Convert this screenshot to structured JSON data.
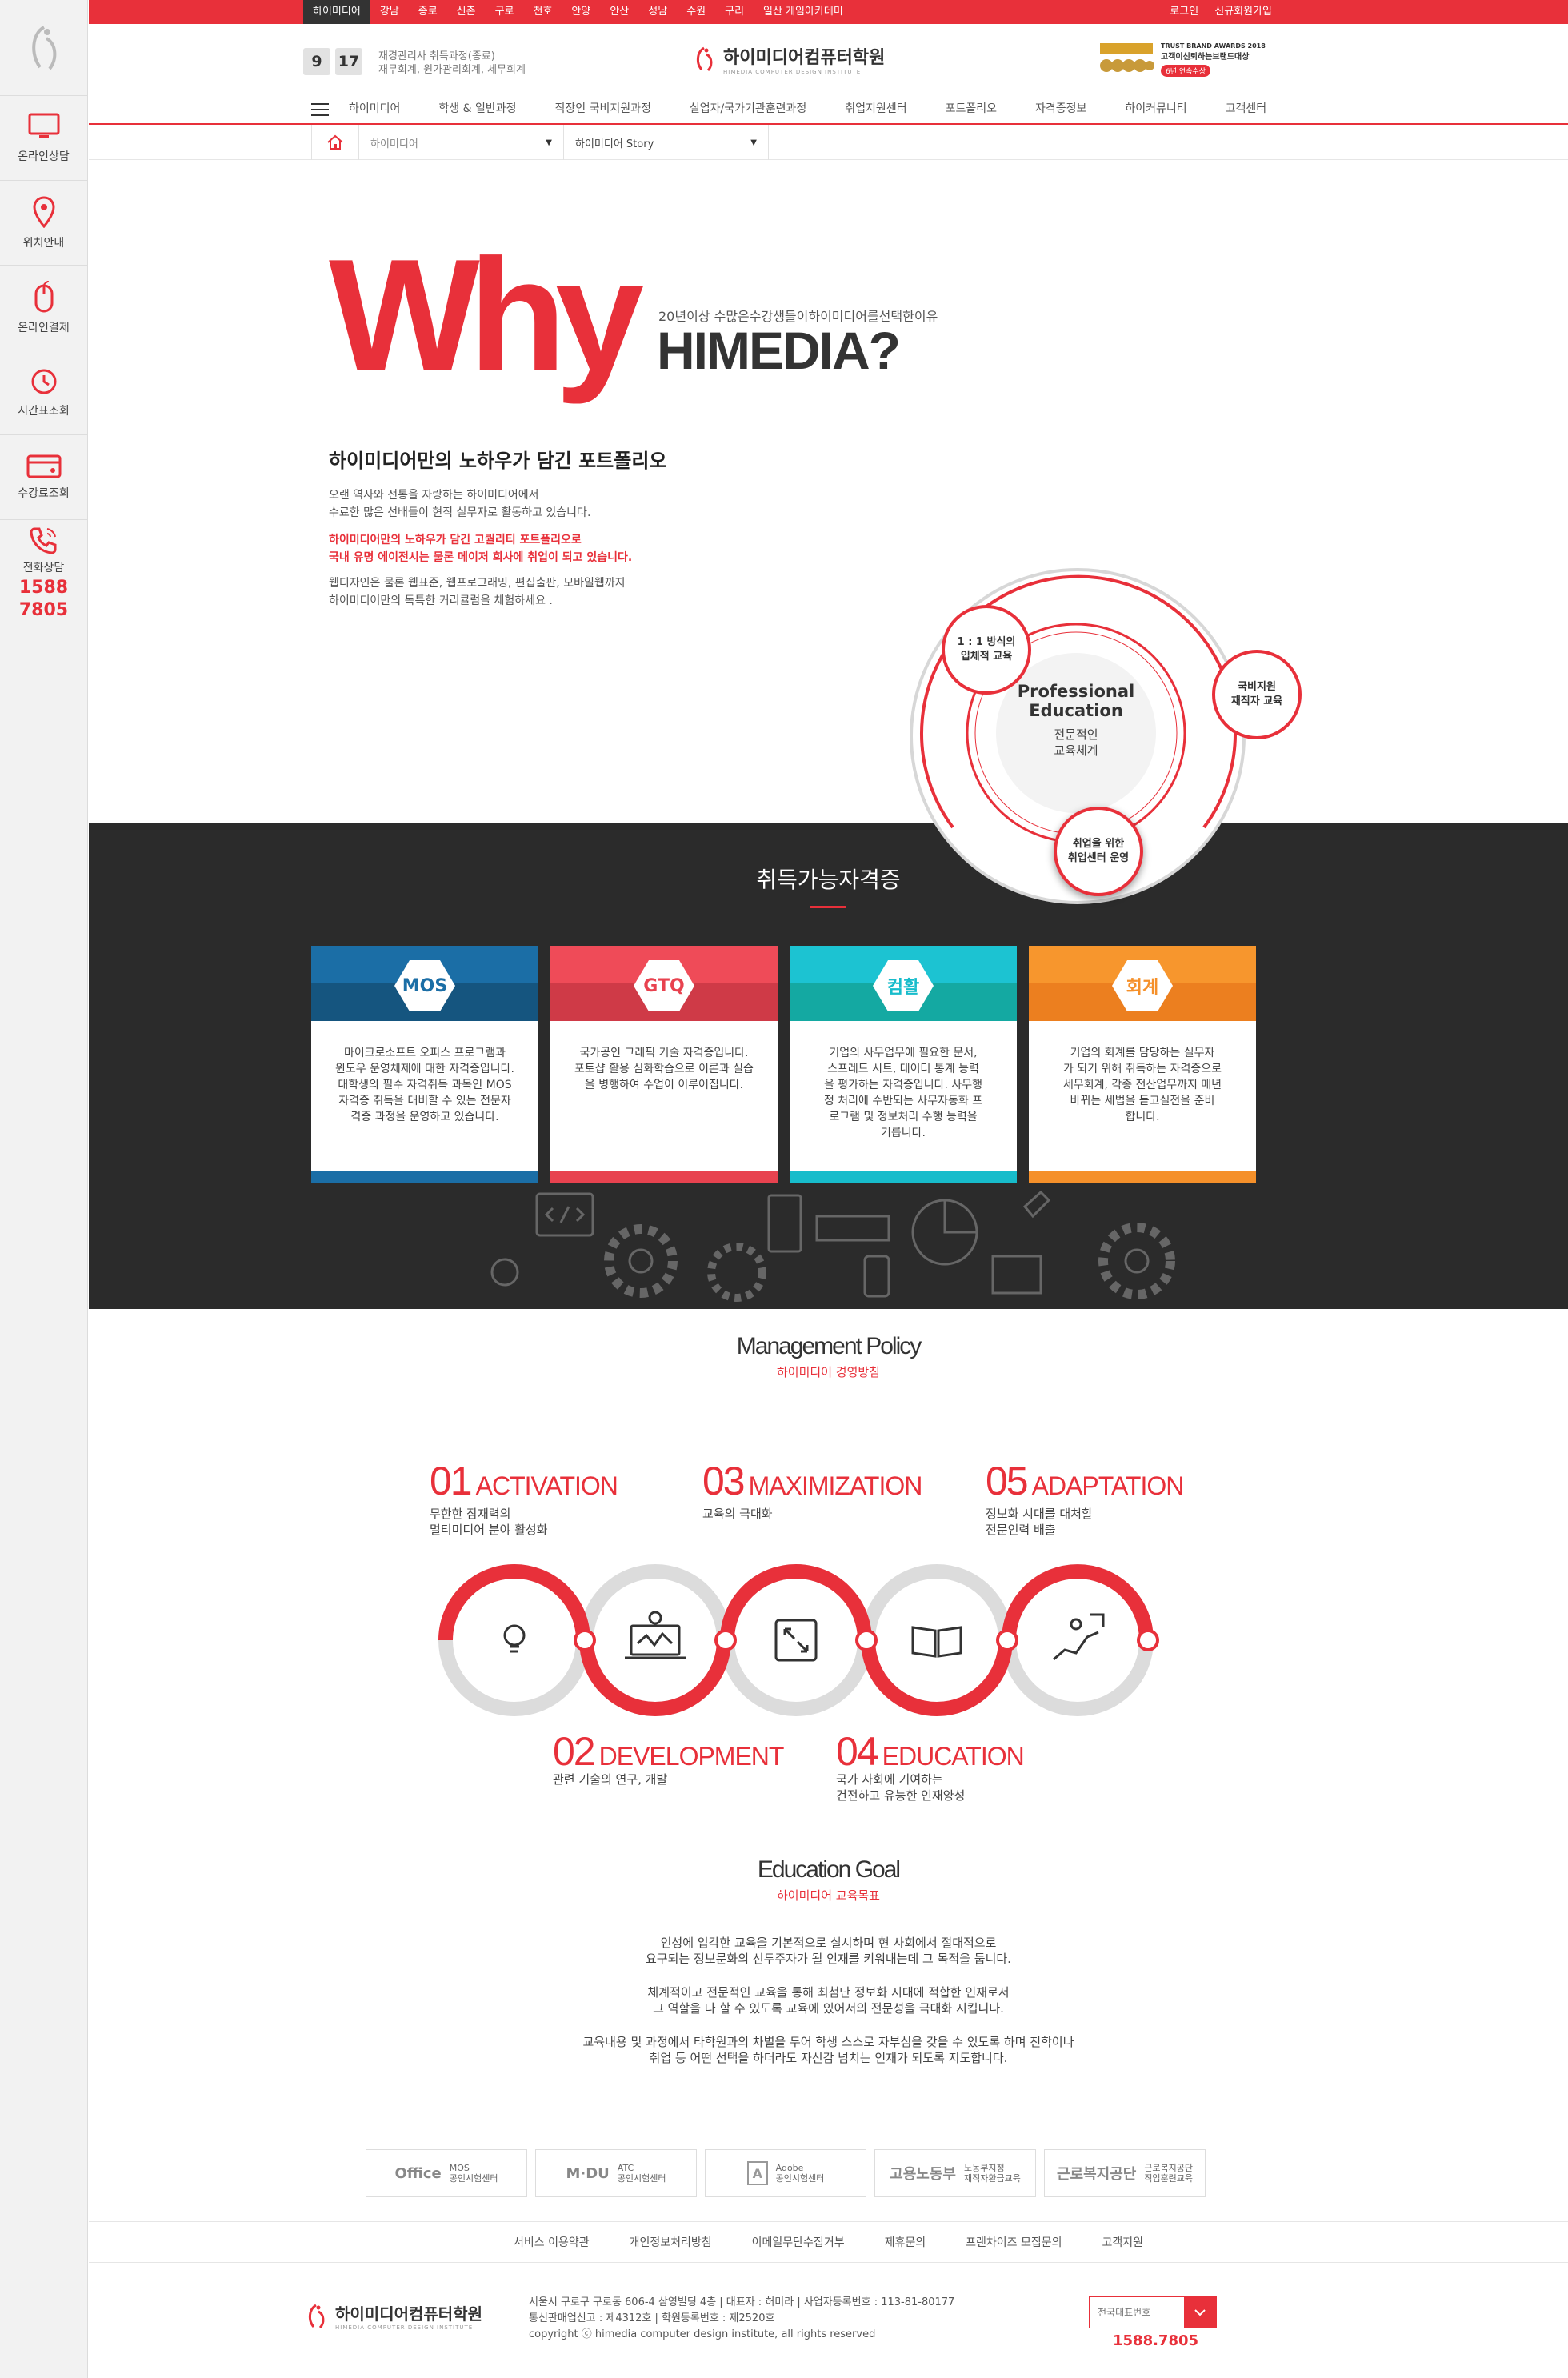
{
  "sidebar": {
    "items": [
      {
        "label": "온라인상담",
        "icon": "monitor-icon"
      },
      {
        "label": "위치안내",
        "icon": "location-pin-icon"
      },
      {
        "label": "온라인결제",
        "icon": "mouse-icon"
      },
      {
        "label": "시간표조회",
        "icon": "clock-icon"
      },
      {
        "label": "수강료조회",
        "icon": "credit-card-icon"
      }
    ],
    "phone_label": "전화상담",
    "phone_line1": "1588",
    "phone_line2": "7805"
  },
  "topbar": {
    "regions": [
      "하이미디어",
      "강남",
      "종로",
      "신촌",
      "구로",
      "천호",
      "안양",
      "안산",
      "성남",
      "수원",
      "구리",
      "일산 게임아카데미"
    ],
    "links": [
      "로그인",
      "신규회원가입"
    ]
  },
  "header": {
    "date_month": "9",
    "date_day": "17",
    "date_line1": "재경관리사 취득과정(종료)",
    "date_line2": "재무회계, 원가관리회계, 세무회계",
    "brand_name": "하이미디어컴퓨터학원",
    "brand_sub": "HIMEDIA COMPUTER DESIGN INSTITUTE",
    "award_line1": "TRUST BRAND AWARDS 2018",
    "award_line2": "고객이신뢰하는브랜드대상",
    "award_badge": "6년 연속수상"
  },
  "nav": {
    "items": [
      "하이미디어",
      "학생 & 일반과정",
      "직장인 국비지원과정",
      "실업자/국가기관훈련과정",
      "취업지원센터",
      "포트폴리오",
      "자격증정보",
      "하이커뮤니티",
      "고객센터"
    ]
  },
  "breadcrumb": {
    "sel1": "하이미디어",
    "sel2": "하이미디어 Story"
  },
  "why": {
    "big": "Why",
    "sub": "20년이상 수많은수강생들이하이미디어를선택한이유",
    "brand": "HIMEDIA?"
  },
  "intro": {
    "heading": "하이미디어만의 노하우가 담긴 포트폴리오",
    "p1a": "오랜 역사와 전통을 자랑하는 하이미디어에서",
    "p1b": "수료한 많은 선배들이 현직 실무자로 활동하고 있습니다.",
    "p2a": "하이미디어만의 노하우가 담긴 고퀄리티 포트폴리오로",
    "p2b": "국내 유명 에이전시는 물론 메이저 회사에 취업이 되고 있습니다.",
    "p3a": "웹디자인은 물론 웹표준, 웹프로그래밍, 편집출판, 모바일웹까지",
    "p3b": "하이미디어만의 독특한 커리큘럼을 체험하세요 ."
  },
  "circle": {
    "center_en1": "Professional",
    "center_en2": "Education",
    "center_ko1": "전문적인",
    "center_ko2": "교육체계",
    "node1a": "1 : 1 방식의",
    "node1b": "입체적 교육",
    "node2a": "국비지원",
    "node2b": "재직자 교육",
    "node3a": "취업을 위한",
    "node3b": "취업센터 운영"
  },
  "certs": {
    "title": "취득가능자격증",
    "cards": [
      {
        "badge": "MOS",
        "color": "#1b6ea6",
        "text": [
          "마이크로소프트 오피스 프로그램과",
          "윈도우 운영체제에 대한 자격증입니다.",
          "대학생의 필수 자격취득 과목인 MOS",
          "자격증 취득을 대비할 수 있는 전문자",
          "격증 과정을 운영하고 있습니다."
        ]
      },
      {
        "badge": "GTQ",
        "color": "#e8424f",
        "text": [
          "국가공인 그래픽 기술 자격증입니다.",
          "포토샵 활용 심화학습으로 이론과 실습",
          "을 병행하여 수업이 이루어집니다."
        ]
      },
      {
        "badge": "컴활",
        "color": "#17bccb",
        "text": [
          "기업의 사무업무에 필요한 문서,",
          "스프레드 시트, 데이터 통계 능력",
          "을 평가하는 자격증입니다. 사무행",
          "정 처리에 수반되는 사무자동화 프",
          "로그램 및 정보처리 수행 능력을",
          "기릅니다."
        ]
      },
      {
        "badge": "회계",
        "color": "#f5902a",
        "text": [
          "기업의 회계를 담당하는 실무자",
          "가 되기 위해 취득하는 자격증으로",
          "세무회계, 각종 전산업무까지 매년",
          "바뀌는 세법을 듣고실전을 준비",
          "합니다."
        ]
      }
    ]
  },
  "policy": {
    "title": "Management Policy",
    "subtitle": "하이미디어 경영방침",
    "items": [
      {
        "num": "01",
        "name": "ACTIVATION",
        "d1": "무한한 잠재력의",
        "d2": "멀티미디어 분야 활성화",
        "icon": "lightbulb-icon"
      },
      {
        "num": "02",
        "name": "DEVELOPMENT",
        "d1": "관련 기술의 연구, 개발",
        "d2": "",
        "icon": "laptop-gear-icon"
      },
      {
        "num": "03",
        "name": "MAXIMIZATION",
        "d1": "교육의 극대화",
        "d2": "",
        "icon": "expand-icon"
      },
      {
        "num": "04",
        "name": "EDUCATION",
        "d1": "국가 사회에 기여하는",
        "d2": "건전하고 유능한 인재양성",
        "icon": "book-icon"
      },
      {
        "num": "05",
        "name": "ADAPTATION",
        "d1": "정보화 시대를 대처할",
        "d2": "전문인력 배출",
        "icon": "climbing-icon"
      }
    ]
  },
  "goal": {
    "title": "Education Goal",
    "subtitle": "하이미디어 교육목표",
    "l1": "인성에 입각한 교육을 기본적으로 실시하며 현 사회에서 절대적으로",
    "l2": "요구되는 정보문화의 선두주자가 될 인재를 키워내는데 그 목적을 둡니다.",
    "l3": "체계적이고 전문적인 교육을 통해 최첨단 정보화 시대에 적합한 인재로서",
    "l4": "그 역할을 다 할 수 있도록 교육에 있어서의 전문성을 극대화 시킵니다.",
    "l5": "교육내용 및 과정에서 타학원과의 차별을 두어 학생 스스로 자부심을 갖을 수 있도록 하며 진학이나",
    "l6": "취업 등 어떤 선택을 하더라도 자신감 넘치는 인재가 되도록 지도합니다."
  },
  "partners": [
    {
      "name": "Office",
      "s1": "MOS",
      "s2": "공인시험센터"
    },
    {
      "name": "M·DU",
      "s1": "ATC",
      "s2": "공인시험센터"
    },
    {
      "name": "Adobe",
      "s1": "Adobe",
      "s2": "공인시험센터"
    },
    {
      "name": "고용노동부",
      "s1": "노동부지정",
      "s2": "재직자환급교육"
    },
    {
      "name": "근로복지공단",
      "s1": "근로복지공단",
      "s2": "직업훈련교육"
    }
  ],
  "footer": {
    "links": [
      "서비스 이용약관",
      "개인정보처리방침",
      "이메일무단수집거부",
      "제휴문의",
      "프랜차이즈 모집문의",
      "고객지원"
    ],
    "brand_name": "하이미디어컴퓨터학원",
    "brand_sub": "HIMEDIA COMPUTER DESIGN INSTITUTE",
    "info1": "서울시 구로구 구로동 606-4 삼영빌딩 4층   |   대표자 : 허미라   |   사업자등록번호 : 113-81-80177",
    "info2": "통신판매업신고 : 제4312호   |   학원등록번호 : 제2520호",
    "info3": "copyright ⓒ himedia computer design institute, all rights reserved",
    "select_placeholder": "전국대표번호",
    "phone": "1588.7805"
  }
}
